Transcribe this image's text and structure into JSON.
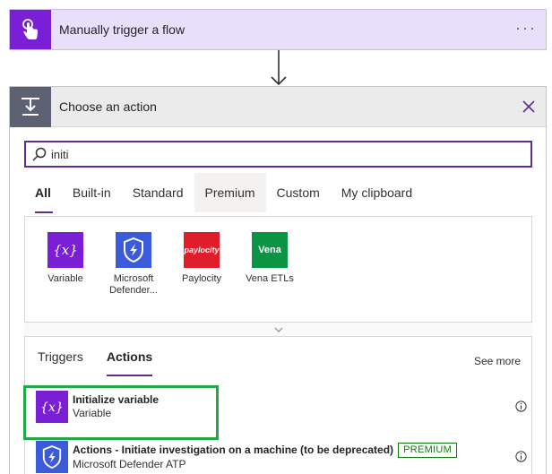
{
  "trigger": {
    "title": "Manually trigger a flow",
    "more": "···",
    "accent": "#7a1fd6"
  },
  "panel": {
    "title": "Choose an action"
  },
  "search": {
    "value": "initi",
    "placeholder": ""
  },
  "tabs": [
    {
      "label": "All",
      "active": true
    },
    {
      "label": "Built-in"
    },
    {
      "label": "Standard"
    },
    {
      "label": "Premium",
      "hover": true
    },
    {
      "label": "Custom"
    },
    {
      "label": "My clipboard"
    }
  ],
  "connectors": [
    {
      "label": "Variable",
      "icon": "variable-icon",
      "color": "#7a1fd6"
    },
    {
      "label": "Microsoft Defender...",
      "label_line1": "Microsoft",
      "label_line2": "Defender...",
      "icon": "defender-icon",
      "color": "#3b5bdb"
    },
    {
      "label": "Paylocity",
      "icon": "paylocity-icon",
      "color": "#e01e2b",
      "logo_text": "paylocity"
    },
    {
      "label": "Vena ETLs",
      "icon": "vena-icon",
      "color": "#0b9444",
      "logo_text": "Vena"
    }
  ],
  "results": {
    "subtabs": [
      {
        "label": "Triggers"
      },
      {
        "label": "Actions",
        "active": true
      }
    ],
    "see_more": "See more",
    "items": [
      {
        "name": "Initialize variable",
        "sub": "Variable",
        "icon": "variable-icon"
      },
      {
        "name": "Actions - Initiate investigation on a machine (to be deprecated)",
        "sub": "Microsoft Defender ATP",
        "badge": "PREMIUM",
        "icon": "defender-icon"
      }
    ]
  },
  "colors": {
    "accent": "#5c2d91",
    "highlight": "#22a844",
    "premium": "#107c10"
  }
}
